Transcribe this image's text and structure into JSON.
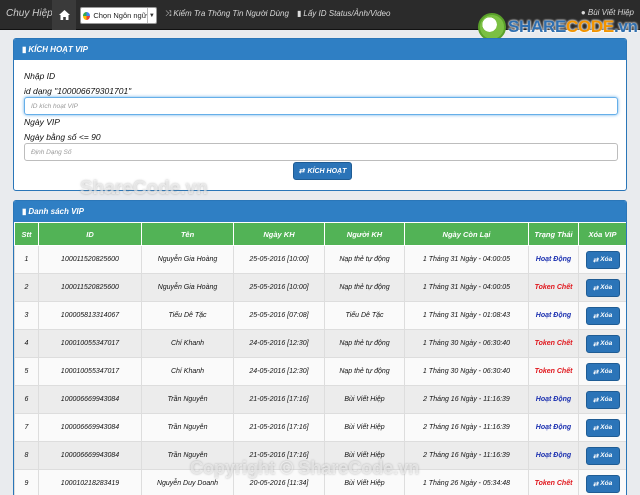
{
  "navbar": {
    "brand": "Chuy Hiệp",
    "language_select": "Chọn Ngôn ngữ",
    "links": [
      "Kiểm Tra Thông Tin Người Dùng",
      "Lấy ID Status/Ảnh/Video"
    ],
    "user": "Bùi Viết Hiệp"
  },
  "logo": {
    "text_a": "SHARE",
    "text_b": "CODE",
    "text_c": ".vn"
  },
  "activate_panel": {
    "title": "KÍCH HOẠT VIP",
    "id_label": "Nhập ID",
    "id_hint": "id dạng \"100006679301701\"",
    "id_placeholder": "ID kích hoạt VIP",
    "days_label": "Ngày VIP",
    "days_hint": "Ngày bằng số <= 90",
    "days_placeholder": "Định Dạng Số",
    "submit_label": "KÍCH HOẠT"
  },
  "vip_list": {
    "title": "Danh sách VIP",
    "columns": [
      "Stt",
      "ID",
      "Tên",
      "Ngày KH",
      "Người KH",
      "Ngày Còn Lại",
      "Trạng Thái",
      "Xóa VIP"
    ],
    "delete_label": "Xóa",
    "rows": [
      {
        "stt": "1",
        "id": "100011520825600",
        "name": "Nguyễn Gia Hoàng",
        "date": "25-05-2016 [10:00]",
        "by": "Nạp thẻ tự động",
        "remaining": "1 Tháng 31 Ngày - 04:00:05",
        "status": "Hoạt Động",
        "active": true
      },
      {
        "stt": "2",
        "id": "100011520825600",
        "name": "Nguyễn Gia Hoàng",
        "date": "25-05-2016 [10:00]",
        "by": "Nạp thẻ tự động",
        "remaining": "1 Tháng 31 Ngày - 04:00:05",
        "status": "Token Chết",
        "active": false
      },
      {
        "stt": "3",
        "id": "100005813314067",
        "name": "Tiểu Dê Tặc",
        "date": "25-05-2016 [07:08]",
        "by": "Tiểu Dê Tặc",
        "remaining": "1 Tháng 31 Ngày - 01:08:43",
        "status": "Hoạt Động",
        "active": true
      },
      {
        "stt": "4",
        "id": "100010055347017",
        "name": "Chí Khanh",
        "date": "24-05-2016 [12:30]",
        "by": "Nạp thẻ tự động",
        "remaining": "1 Tháng 30 Ngày - 06:30:40",
        "status": "Token Chết",
        "active": false
      },
      {
        "stt": "5",
        "id": "100010055347017",
        "name": "Chí Khanh",
        "date": "24-05-2016 [12:30]",
        "by": "Nạp thẻ tự động",
        "remaining": "1 Tháng 30 Ngày - 06:30:40",
        "status": "Token Chết",
        "active": false
      },
      {
        "stt": "6",
        "id": "100006669943084",
        "name": "Trần Nguyên",
        "date": "21-05-2016 [17:16]",
        "by": "Bùi Viết Hiệp",
        "remaining": "2 Tháng 16 Ngày - 11:16:39",
        "status": "Hoạt Động",
        "active": true
      },
      {
        "stt": "7",
        "id": "100006669943084",
        "name": "Trần Nguyên",
        "date": "21-05-2016 [17:16]",
        "by": "Bùi Viết Hiệp",
        "remaining": "2 Tháng 16 Ngày - 11:16:39",
        "status": "Hoạt Động",
        "active": true
      },
      {
        "stt": "8",
        "id": "100006669943084",
        "name": "Trần Nguyên",
        "date": "21-05-2016 [17:16]",
        "by": "Bùi Viết Hiệp",
        "remaining": "2 Tháng 16 Ngày - 11:16:39",
        "status": "Hoạt Động",
        "active": true
      },
      {
        "stt": "9",
        "id": "100010218283419",
        "name": "Nguyễn Duy Doanh",
        "date": "20-05-2016 [11:34]",
        "by": "Bùi Viết Hiệp",
        "remaining": "1 Tháng 26 Ngày - 05:34:48",
        "status": "Token Chết",
        "active": false
      }
    ]
  },
  "watermarks": [
    "ShareCode.vn",
    "Copyright © ShareCode.vn"
  ],
  "colors": {
    "header_blue": "#2f7fc4",
    "table_head_green": "#52b356",
    "status_active": "#1a2fb0",
    "status_dead": "#e0151b"
  }
}
